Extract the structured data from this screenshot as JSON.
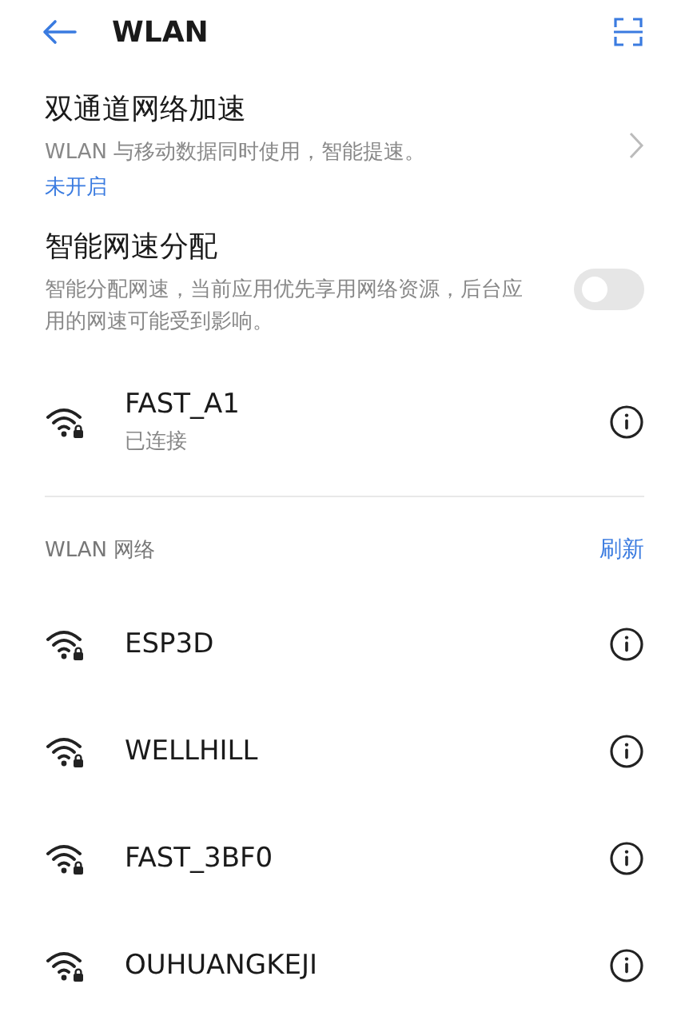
{
  "header": {
    "title": "WLAN"
  },
  "settings": [
    {
      "kind": "link",
      "title": "双通道网络加速",
      "description": "WLAN 与移动数据同时使用，智能提速。",
      "status": "未开启"
    },
    {
      "kind": "toggle",
      "title": "智能网速分配",
      "description": "智能分配网速，当前应用优先享用网络资源，后台应用的网速可能受到影响。",
      "on": false
    }
  ],
  "connected": {
    "name": "FAST_A1",
    "status": "已连接",
    "locked": true
  },
  "networks_section": {
    "title": "WLAN 网络",
    "action": "刷新"
  },
  "networks": [
    {
      "name": "ESP3D",
      "locked": true
    },
    {
      "name": "WELLHILL",
      "locked": true
    },
    {
      "name": "FAST_3BF0",
      "locked": true
    },
    {
      "name": "OUHUANGKEJI",
      "locked": true
    }
  ]
}
